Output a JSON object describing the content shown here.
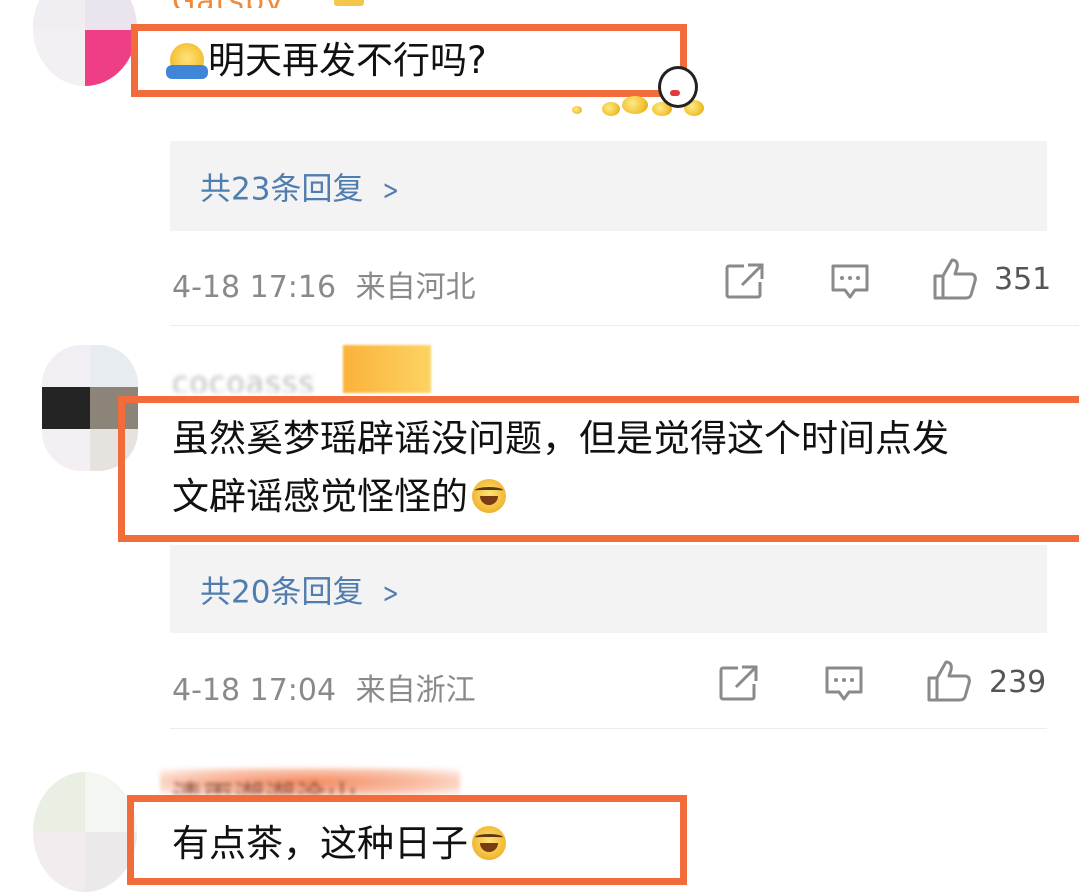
{
  "comments": [
    {
      "username": "Gatsby",
      "text_lines": [
        "明天再发不行吗?"
      ],
      "replies_label": "共23条回复",
      "time": "4-18 17:16",
      "location": "来自河北",
      "likes": "351"
    },
    {
      "username": "cocoasss",
      "text_lines": [
        "虽然奚梦瑶辟谣没问题，但是觉得这个时间点发",
        "文辟谣感觉怪怪的"
      ],
      "replies_label": "共20条回复",
      "time": "4-18 17:04",
      "location": "来自浙江",
      "likes": "239"
    },
    {
      "username": "清雨潮潮涂山",
      "text_lines": [
        "有点茶，这种日子"
      ]
    }
  ],
  "icons": {
    "share": "share-icon",
    "comment": "comment-icon",
    "like": "thumbs-up-icon",
    "reply_chevron": "chevron-right-icon"
  },
  "colors": {
    "highlight": "#f26b3a",
    "reply_link": "#507daf",
    "meta_text": "#8a8a8a",
    "username": "#f08a3a"
  }
}
